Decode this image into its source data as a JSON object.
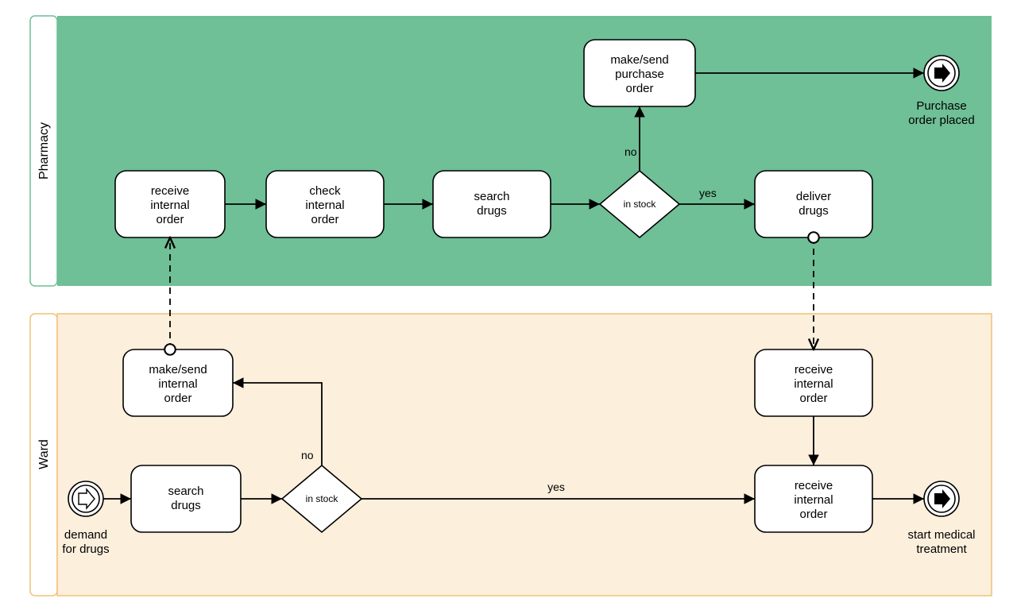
{
  "lanes": {
    "pharmacy_label": "Pharmacy",
    "ward_label": "Ward"
  },
  "pharmacy": {
    "receive_internal_order": "receive\ninternal\norder",
    "check_internal_order": "check\ninternal\norder",
    "search_drugs": "search\ndrugs",
    "in_stock": "in stock",
    "no": "no",
    "yes": "yes",
    "make_send_purchase_order": "make/send\npurchase\norder",
    "deliver_drugs": "deliver\ndrugs",
    "purchase_order_placed": "Purchase\norder placed"
  },
  "ward": {
    "demand_for_drugs": "demand\nfor drugs",
    "search_drugs": "search\ndrugs",
    "in_stock": "in stock",
    "no": "no",
    "yes": "yes",
    "make_send_internal_order": "make/send\ninternal\norder",
    "receive_internal_order_1": "receive\ninternal\norder",
    "receive_internal_order_2": "receive\ninternal\norder",
    "start_medical_treatment": "start medical\ntreatment"
  }
}
